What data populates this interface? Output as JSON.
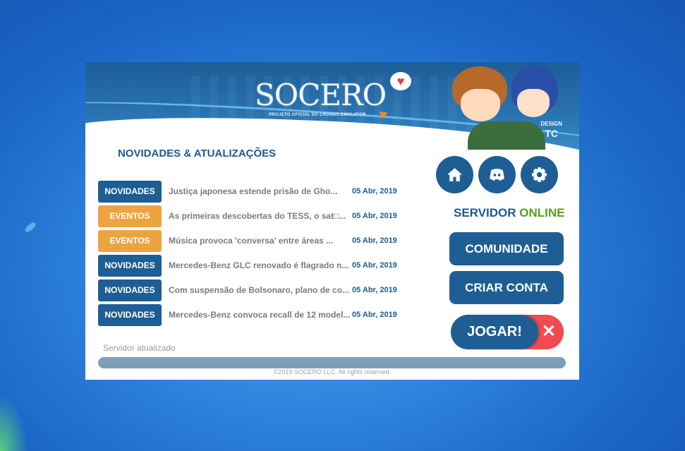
{
  "launcher": {
    "logo": {
      "wordmark": "SOCERO",
      "tagline": "PROJETO OFICIAL DO CRONUS EMULATOR"
    },
    "design_credit": [
      "DESIGN",
      "TC"
    ],
    "news": {
      "tab_title": "NOVIDADES & ATUALIZAÇÕES",
      "items": [
        {
          "category": "NOVIDADES",
          "category_color": "#1e5e94",
          "title": "Justiça japonesa estende prisão de Gho...",
          "date": "05 Abr, 2019"
        },
        {
          "category": "EVENTOS",
          "category_color": "#eda33f",
          "title": "As primeiras descobertas do TESS, o sat□...",
          "date": "05 Abr, 2019"
        },
        {
          "category": "EVENTOS",
          "category_color": "#eda33f",
          "title": "Música provoca 'conversa' entre áreas ...",
          "date": "05 Abr, 2019"
        },
        {
          "category": "NOVIDADES",
          "category_color": "#1e5e94",
          "title": "Mercedes-Benz GLC renovado é flagrado n...",
          "date": "05 Abr, 2019"
        },
        {
          "category": "NOVIDADES",
          "category_color": "#1e5e94",
          "title": "Com suspensão de Bolsonaro, plano de co...",
          "date": "05 Abr, 2019"
        },
        {
          "category": "NOVIDADES",
          "category_color": "#1e5e94",
          "title": "Mercedes-Benz convoca recall de 12 model...",
          "date": "05 Abr, 2019"
        }
      ]
    },
    "icon_buttons": [
      {
        "icon": "home-icon"
      },
      {
        "icon": "discord-icon"
      },
      {
        "icon": "gear-icon"
      }
    ],
    "server": {
      "label": "SERVIDOR",
      "status": "ONLINE",
      "status_color": "#5c9b1f"
    },
    "buttons": {
      "community": "COMUNIDADE",
      "create_account": "CRIAR CONTA",
      "play": "JOGAR!",
      "close": "✕"
    },
    "status_text": "Servidor atualizado",
    "progress_percent": 100,
    "footer": "©2019 SOCERO LLC. All rights reserved."
  }
}
